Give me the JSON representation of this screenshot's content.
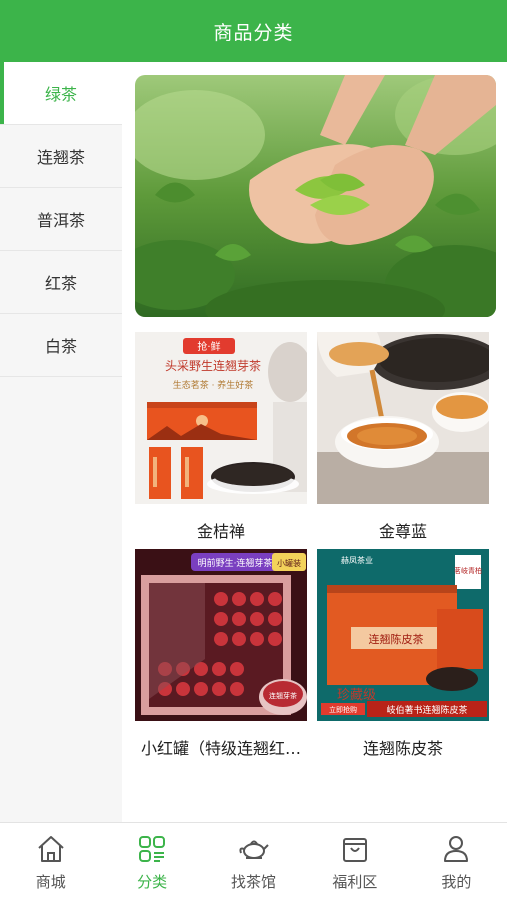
{
  "header": {
    "title": "商品分类"
  },
  "sidebar": {
    "items": [
      {
        "label": "绿茶"
      },
      {
        "label": "连翘茶"
      },
      {
        "label": "普洱茶"
      },
      {
        "label": "红茶"
      },
      {
        "label": "白茶"
      }
    ],
    "active_index": 0
  },
  "products": [
    {
      "name": "金桔禅",
      "image_text": {
        "badge": "抢·鲜",
        "headline": "头采野生连翘芽茶",
        "sub": "生态茗茶 · 养生好茶"
      }
    },
    {
      "name": "金尊蓝"
    },
    {
      "name": "小红罐（特级连翘红…",
      "image_text": {
        "banner": "明前野生·连翘芽茶",
        "tag": "小罐装",
        "lid": "连翘芽茶"
      }
    },
    {
      "name": "连翘陈皮茶",
      "image_text": {
        "brand": "赫凤茶业",
        "seal": "茗岐青柏",
        "box": "连翘陈皮茶",
        "grade": "珍藏级",
        "stamp": "立即抢购",
        "slogan": "岐伯著书连翘陈皮茶"
      }
    }
  ],
  "tabbar": {
    "items": [
      {
        "label": "商城",
        "icon": "home-icon"
      },
      {
        "label": "分类",
        "icon": "category-icon"
      },
      {
        "label": "找茶馆",
        "icon": "teapot-icon"
      },
      {
        "label": "福利区",
        "icon": "gift-bag-icon"
      },
      {
        "label": "我的",
        "icon": "user-icon"
      }
    ],
    "active_index": 1
  },
  "colors": {
    "brand_green": "#3cb44a",
    "sidebar_bg": "#f6f6f6",
    "text": "#222222"
  }
}
